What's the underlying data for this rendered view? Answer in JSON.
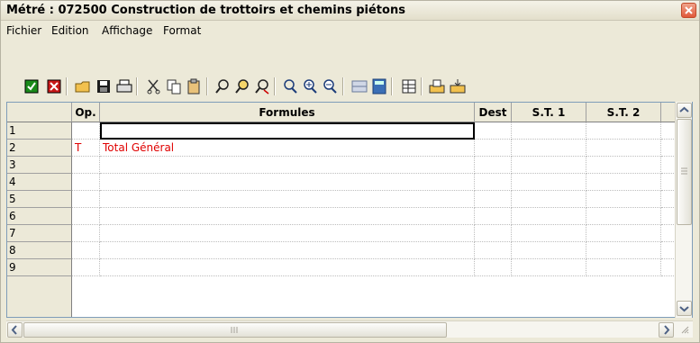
{
  "window": {
    "title": "Métré : 072500 Construction de trottoirs et chemins piétons"
  },
  "menu": [
    "Fichier",
    "Edition",
    "Affichage",
    "Format"
  ],
  "toolbar": {
    "icons": [
      "validate-icon",
      "cancel-icon",
      "open-icon",
      "save-icon",
      "print-icon",
      "cut-icon",
      "copy-icon",
      "paste-icon",
      "find-icon",
      "find-next-icon",
      "replace-icon",
      "zoom-icon",
      "zoom-in-icon",
      "zoom-out-icon",
      "insert-row-icon",
      "calculator-icon",
      "table-icon",
      "export-icon",
      "import-icon"
    ]
  },
  "grid": {
    "columns": [
      "Op.",
      "Formules",
      "Dest",
      "S.T. 1",
      "S.T. 2"
    ],
    "rows": [
      {
        "num": "1",
        "op": "",
        "formula": ""
      },
      {
        "num": "2",
        "op": "T",
        "formula": "Total Général"
      },
      {
        "num": "3",
        "op": "",
        "formula": ""
      },
      {
        "num": "4",
        "op": "",
        "formula": ""
      },
      {
        "num": "5",
        "op": "",
        "formula": ""
      },
      {
        "num": "6",
        "op": "",
        "formula": ""
      },
      {
        "num": "7",
        "op": "",
        "formula": ""
      },
      {
        "num": "8",
        "op": "",
        "formula": ""
      },
      {
        "num": "9",
        "op": "",
        "formula": ""
      }
    ],
    "active_row": "1",
    "accent_color": "#e00000"
  }
}
